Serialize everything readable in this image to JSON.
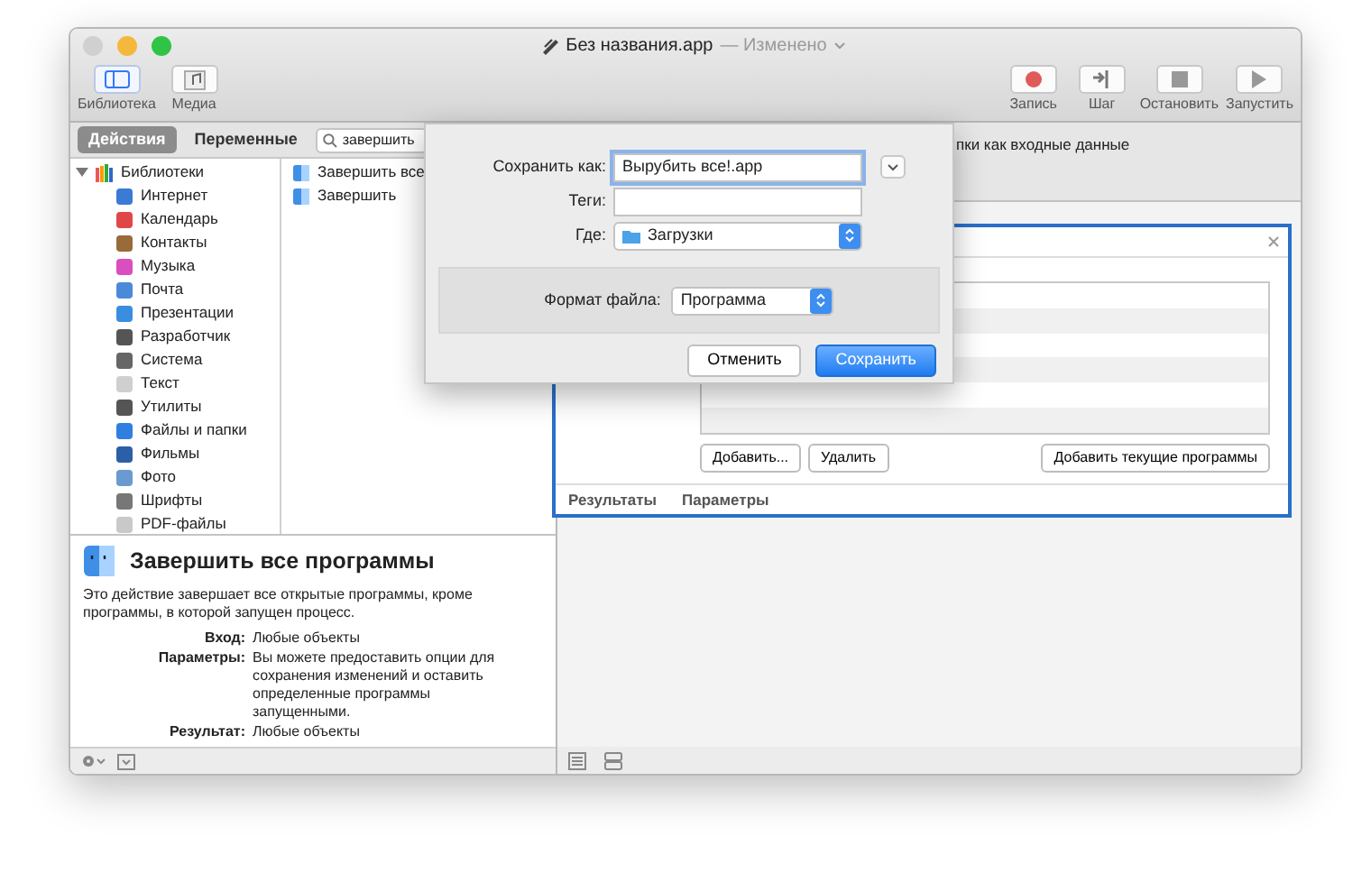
{
  "window": {
    "title": "Без названия.app",
    "subtitle": "— Изменено"
  },
  "toolbar": {
    "left": [
      {
        "label": "Библиотека",
        "selected": true
      },
      {
        "label": "Медиа",
        "selected": false
      }
    ],
    "right": [
      {
        "label": "Запись",
        "kind": "record"
      },
      {
        "label": "Шаг",
        "kind": "step"
      },
      {
        "label": "Остановить",
        "kind": "stop"
      },
      {
        "label": "Запустить",
        "kind": "run"
      }
    ]
  },
  "tabs": [
    {
      "label": "Действия",
      "selected": true
    },
    {
      "label": "Переменные",
      "selected": false
    }
  ],
  "search": {
    "value": "завершить"
  },
  "library": {
    "label": "Библиотеки",
    "expanded": true,
    "children": [
      {
        "label": "Интернет"
      },
      {
        "label": "Календарь"
      },
      {
        "label": "Контакты"
      },
      {
        "label": "Музыка"
      },
      {
        "label": "Почта"
      },
      {
        "label": "Презентации"
      },
      {
        "label": "Разработчик"
      },
      {
        "label": "Система"
      },
      {
        "label": "Текст"
      },
      {
        "label": "Утилиты"
      },
      {
        "label": "Файлы и папки"
      },
      {
        "label": "Фильмы"
      },
      {
        "label": "Фото"
      },
      {
        "label": "Шрифты"
      },
      {
        "label": "PDF-файлы"
      }
    ]
  },
  "actions": [
    "Завершить все",
    "Завершить"
  ],
  "description": {
    "title": "Завершить все программы",
    "text": "Это действие завершает все открытые программы, кроме программы, в которой запущен процесс.",
    "rows": [
      {
        "label": "Вход:",
        "value": "Любые объекты"
      },
      {
        "label": "Параметры:",
        "value": "Вы можете предоставить опции для сохранения изменений и оставить определенные программы запущенными."
      },
      {
        "label": "Результат:",
        "value": "Любые объекты"
      }
    ]
  },
  "workflow": {
    "input_text": "пки как входные данные",
    "card": {
      "buttons": [
        "Добавить...",
        "Удалить",
        "Добавить текущие программы"
      ],
      "footer": [
        "Результаты",
        "Параметры"
      ]
    }
  },
  "dialog": {
    "save_as": {
      "label": "Сохранить как:",
      "value": "Вырубить все!.app"
    },
    "tags": {
      "label": "Теги:"
    },
    "where": {
      "label": "Где:",
      "value": "Загрузки"
    },
    "format": {
      "label": "Формат файла:",
      "value": "Программа"
    },
    "buttons": [
      {
        "label": "Отменить",
        "kind": "cancel"
      },
      {
        "label": "Сохранить",
        "kind": "default"
      }
    ]
  }
}
